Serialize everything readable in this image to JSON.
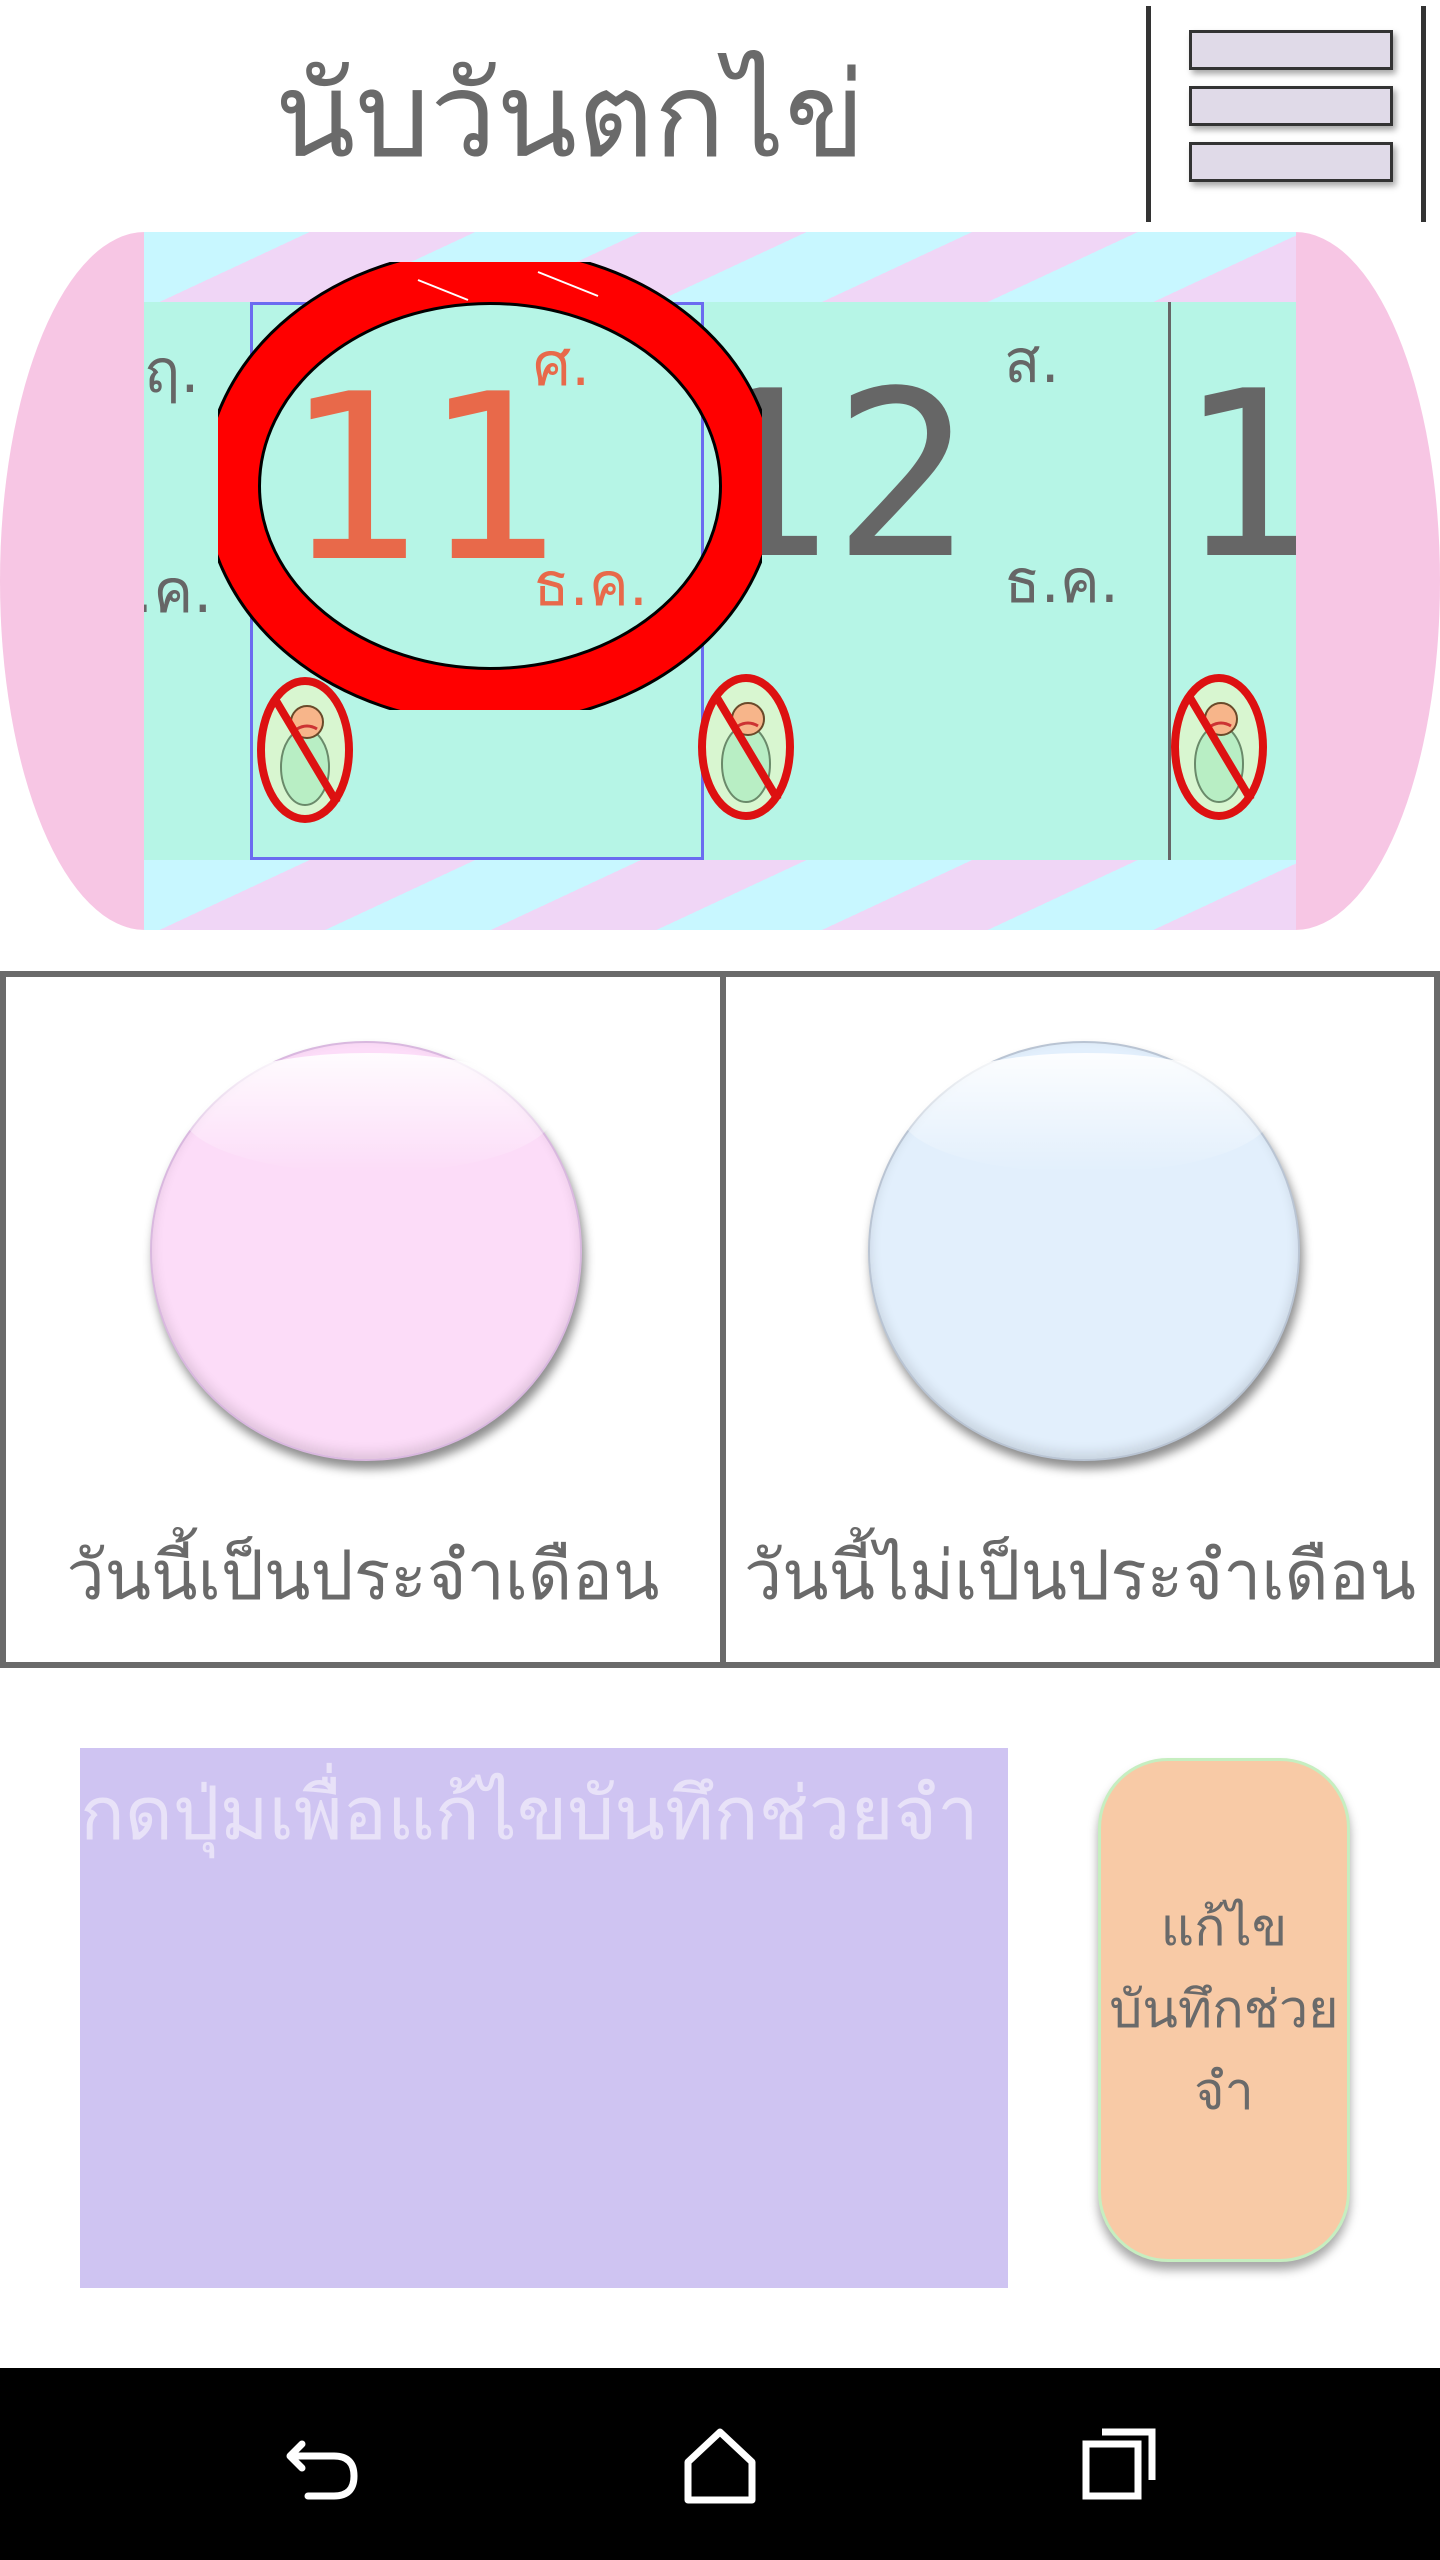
{
  "header": {
    "title": "นับวันตกไข่",
    "menu_icon": "hamburger-menu-icon"
  },
  "calendar": {
    "left_partial": {
      "dow": "ฤ.",
      "month": ".ค."
    },
    "selected": {
      "day": "11",
      "dow": "ศ.",
      "month": "ธ.ค.",
      "color": "#e8694a"
    },
    "next": {
      "day": "12",
      "dow": "ส.",
      "month": "ธ.ค."
    },
    "right_partial": {
      "day": "1"
    },
    "status_icon": "no-baby-icon",
    "today_marker_color": "#ff0000"
  },
  "buttons": {
    "period_yes_label": "วันนี้เป็นประจำเดือน",
    "period_no_label": "วันนี้ไม่เป็นประจำเดือน",
    "period_yes_color": "#fcdcf8",
    "period_no_color": "#e2effc"
  },
  "note": {
    "placeholder": "กดปุ่มเพื่อแก้ไขบันทึกช่วยจำ",
    "edit_button_label": "แก้ไขบันทึกช่วยจำ"
  },
  "navbar": {
    "back_icon": "back-icon",
    "home_icon": "home-icon",
    "recents_icon": "recents-icon"
  }
}
